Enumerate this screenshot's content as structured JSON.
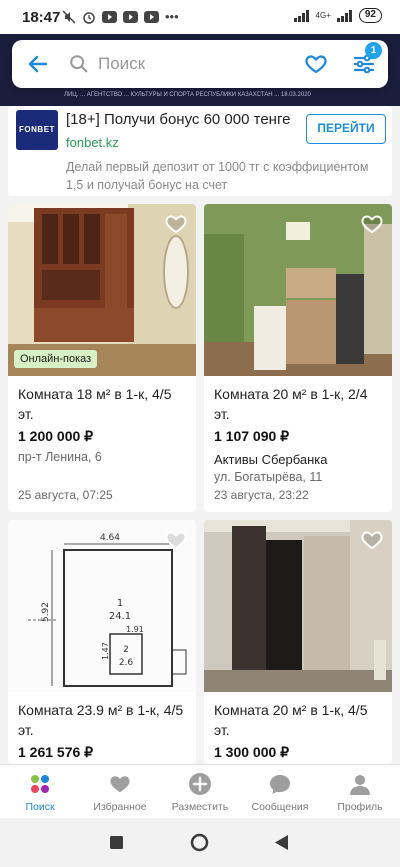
{
  "status_bar": {
    "time": "18:47",
    "network": "4G+",
    "battery": "92"
  },
  "promo_strip": {
    "fine_print": "ЛИЦ. ... АГЕНТСТВО ... КУЛЬТУРЫ И СПОРТА РЕСПУБЛИКИ КАЗАХСТАН ... 18.03.2020"
  },
  "search": {
    "placeholder": "Поиск",
    "filter_count": "1"
  },
  "ad": {
    "logo": "FONBET",
    "title": "[18+] Получи бонус 60 000 тенге",
    "domain": "fonbet.kz",
    "button": "ПЕРЕЙТИ",
    "description": "Делай первый депозит от 1000 тг с коэффициентом 1,5 и получай бонус на счет"
  },
  "listings": [
    {
      "badge": "Онлайн-показ",
      "title": "Комната 18 м² в 1-к, 4/5 эт.",
      "price": "1 200 000 ₽",
      "seller": "",
      "address": "пр-т Ленина, 6",
      "date": "25 августа, 07:25"
    },
    {
      "badge": "",
      "title": "Комната 20 м² в 1-к, 2/4 эт.",
      "price": "1 107 090 ₽",
      "seller": "Активы Сбербанка",
      "address": "ул. Богатырёва, 11",
      "date": "23 августа, 23:22"
    },
    {
      "badge": "",
      "title": "Комната 23.9 м² в 1-к, 4/5 эт.",
      "price": "1 261 576 ₽",
      "seller": "",
      "address": "",
      "date": ""
    },
    {
      "badge": "",
      "title": "Комната 20 м² в 1-к, 4/5 эт.",
      "price": "1 300 000 ₽",
      "seller": "",
      "address": "",
      "date": ""
    }
  ],
  "floorplan": {
    "dim_top": "4.64",
    "dim_side": "5.92",
    "room_no": "1",
    "room_area": "24.1",
    "dim_small": "1.91",
    "dim_small2": "1.47",
    "room2_no": "2",
    "room2_area": "2.6"
  },
  "bottom_nav": [
    {
      "label": "Поиск",
      "icon": "search-dots-icon"
    },
    {
      "label": "Избранное",
      "icon": "heart-icon"
    },
    {
      "label": "Разместить",
      "icon": "plus-icon"
    },
    {
      "label": "Сообщения",
      "icon": "chat-icon"
    },
    {
      "label": "Профиль",
      "icon": "profile-icon"
    }
  ],
  "colors": {
    "accent": "#1e88d8",
    "badge_online": "#d8f0c5",
    "ad_domain": "#2b9b5a"
  }
}
